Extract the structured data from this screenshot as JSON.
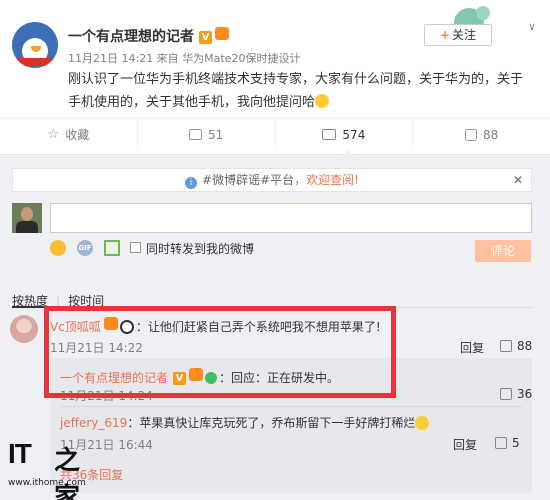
{
  "post": {
    "author": "一个有点理想的记者",
    "meta": "11月21日 14:21 来自 华为Mate20保时捷设计",
    "text": "刚认识了一位华为手机终端技术支持专家，大家有什么问题，关于华为的，关于手机使用的，关于其他手机，我向他提问哈",
    "follow_label": "关注",
    "v_badge": "V"
  },
  "actions": {
    "favorite_label": "收藏",
    "repost_count": "51",
    "comment_count": "574",
    "like_count": "88"
  },
  "notice": {
    "tag": "#微博辟谣#平台",
    "highlight": "，欢迎查阅!"
  },
  "composer": {
    "sync_label": "同时转发到我的微博",
    "submit_label": "评论",
    "gif_text": "GIF"
  },
  "sort": {
    "by_hot": "按热度",
    "by_time": "按时间"
  },
  "comment": {
    "user": "Vc顶呱呱",
    "text": "：让他们赶紧自己弄个系统吧我不想用苹果了!",
    "time": "11月21日 14:22",
    "reply_label": "回复",
    "like_count": "88"
  },
  "sub_replies": [
    {
      "user": "一个有点理想的记者",
      "text": "：回应：正在研发中。",
      "time": "11月21日 14:24",
      "like_count": "36"
    },
    {
      "user": "jeffery_619",
      "text": "：苹果真快让库克玩死了，乔布斯留下一手好牌打稀烂",
      "time": "11月21日 16:44",
      "like_count": "5"
    }
  ],
  "more_replies": "共36条回复",
  "reply_label": "回复",
  "watermark": {
    "logo_it": "IT",
    "logo_zh": "之家",
    "url": "www.ithome.com"
  }
}
